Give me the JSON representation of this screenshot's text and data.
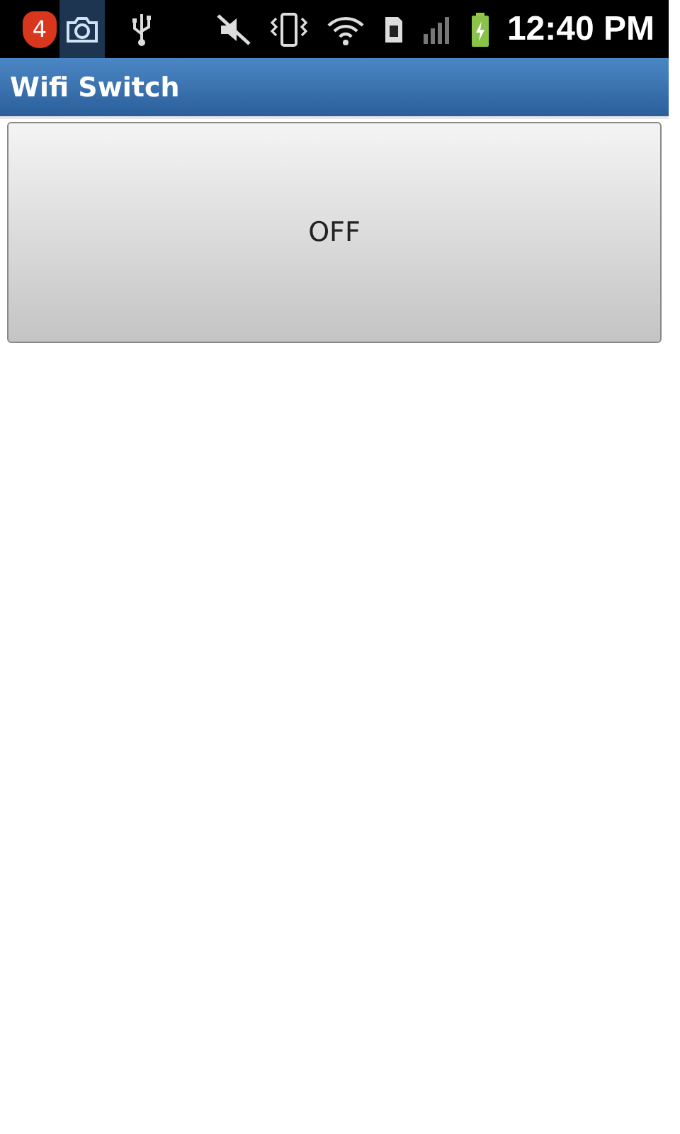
{
  "status_bar": {
    "notification_count": "4",
    "time": "12:40 PM"
  },
  "window": {
    "title": "Wifi Switch"
  },
  "toggle_button": {
    "label": "OFF"
  }
}
